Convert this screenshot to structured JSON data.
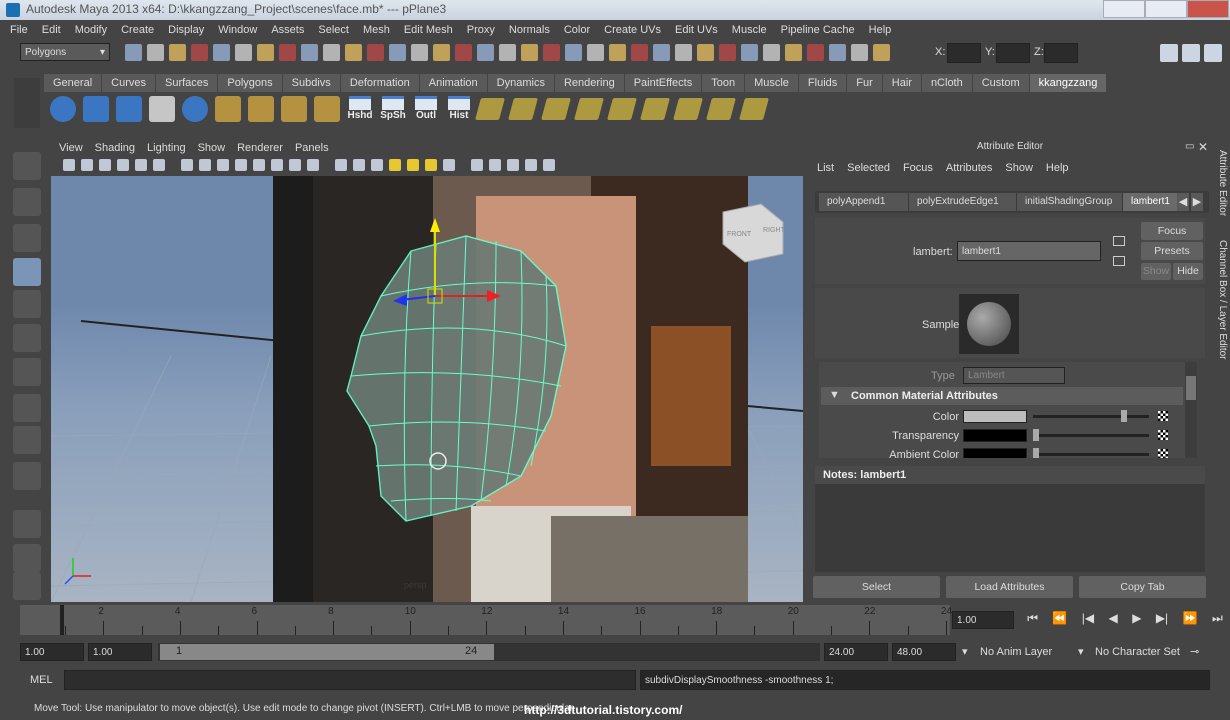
{
  "window": {
    "title": "Autodesk Maya 2013 x64: D:\\kkangzzang_Project\\scenes\\face.mb*   ---   pPlane3"
  },
  "menubar": [
    "File",
    "Edit",
    "Modify",
    "Create",
    "Display",
    "Window",
    "Assets",
    "Select",
    "Mesh",
    "Edit Mesh",
    "Proxy",
    "Normals",
    "Color",
    "Create UVs",
    "Edit UVs",
    "Muscle",
    "Pipeline Cache",
    "Help"
  ],
  "statusline": {
    "mode": "Polygons",
    "x_label": "X:",
    "y_label": "Y:",
    "z_label": "Z:"
  },
  "shelf": {
    "tabs": [
      "General",
      "Curves",
      "Surfaces",
      "Polygons",
      "Subdivs",
      "Deformation",
      "Animation",
      "Dynamics",
      "Rendering",
      "PaintEffects",
      "Toon",
      "Muscle",
      "Fluids",
      "Fur",
      "Hair",
      "nCloth",
      "Custom",
      "kkangzzang"
    ],
    "active_tab": "kkangzzang",
    "labeled_buttons": [
      "Hshd",
      "SpSh",
      "Outl",
      "Hist"
    ]
  },
  "viewport": {
    "menu": [
      "View",
      "Shading",
      "Lighting",
      "Show",
      "Renderer",
      "Panels"
    ],
    "viewcube": {
      "front": "FRONT",
      "right": "RIGHT"
    },
    "overlay_text": "persp"
  },
  "attribute_editor": {
    "title": "Attribute Editor",
    "menu": [
      "List",
      "Selected",
      "Focus",
      "Attributes",
      "Show",
      "Help"
    ],
    "tabs": [
      "polyAppend1",
      "polyExtrudeEdge1",
      "initialShadingGroup",
      "lambert1"
    ],
    "active_tab": "lambert1",
    "node_label": "lambert:",
    "node_value": "lambert1",
    "buttons": {
      "focus": "Focus",
      "presets": "Presets",
      "show": "Show",
      "hide": "Hide"
    },
    "sample_label": "Sample",
    "type_label": "Type",
    "type_value": "Lambert",
    "section_title": "Common Material Attributes",
    "attributes": [
      {
        "label": "Color",
        "swatch": "#bdbdbd",
        "slider": 0.8
      },
      {
        "label": "Transparency",
        "swatch": "#000000",
        "slider": 0.0
      },
      {
        "label": "Ambient Color",
        "swatch": "#000000",
        "slider": 0.0
      }
    ],
    "notes_label": "Notes: lambert1",
    "bottom_buttons": [
      "Select",
      "Load Attributes",
      "Copy Tab"
    ]
  },
  "side_tabs": [
    "Attribute Editor",
    "Channel Box / Layer Editor"
  ],
  "timeline": {
    "ticks": [
      "2",
      "4",
      "6",
      "8",
      "10",
      "12",
      "14",
      "16",
      "18",
      "20",
      "22",
      "24"
    ],
    "current_frame": "1.00"
  },
  "range_slider": {
    "start_time": "1.00",
    "playback_start": "1.00",
    "range_start": "1",
    "range_end": "24",
    "playback_end": "24.00",
    "end_time": "48.00",
    "anim_layer": "No Anim Layer",
    "character_set": "No Character Set"
  },
  "command_line": {
    "label": "MEL",
    "result": "subdivDisplaySmoothness -smoothness 1;"
  },
  "help_line": "Move Tool: Use manipulator to move object(s). Use edit mode to change pivot (INSERT).  Ctrl+LMB to move perpendicular.",
  "watermark": "http://3dtutorial.tistory.com/"
}
